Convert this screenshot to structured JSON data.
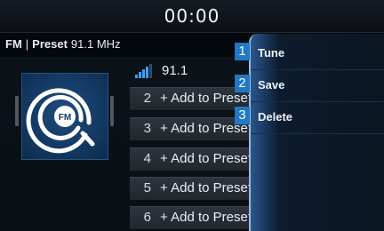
{
  "clock": "00:00",
  "header": {
    "band": "FM",
    "separator": "|",
    "preset_label": "Preset",
    "frequency": "91.1 MHz"
  },
  "now_playing": {
    "frequency": "91.1",
    "signal_icon": "signal-bars-icon"
  },
  "album_art": {
    "badge": "FM",
    "icon": "radio-fm-icon"
  },
  "presets": [
    {
      "number": "2",
      "label": "+ Add to Preset"
    },
    {
      "number": "3",
      "label": "+ Add to Preset"
    },
    {
      "number": "4",
      "label": "+ Add to Preset"
    },
    {
      "number": "5",
      "label": "+ Add to Preset"
    },
    {
      "number": "6",
      "label": "+ Add to Preset"
    }
  ],
  "menu": {
    "items": [
      {
        "number": "1",
        "label": "Tune"
      },
      {
        "number": "2",
        "label": "Save"
      },
      {
        "number": "3",
        "label": "Delete"
      }
    ]
  },
  "colors": {
    "accent": "#1f78c8",
    "menu_bg": "#0c1a2b",
    "art_bg": "#11355c"
  }
}
